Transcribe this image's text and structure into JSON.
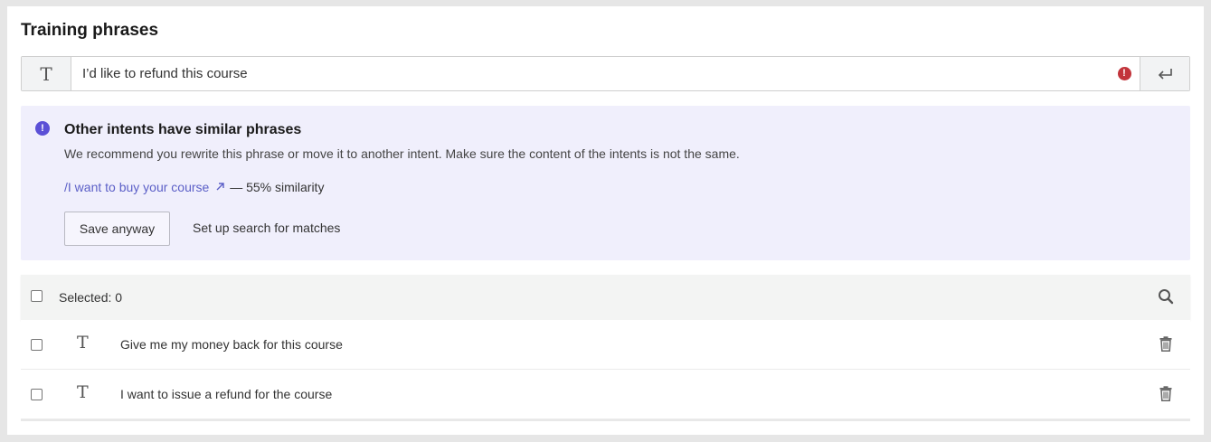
{
  "section": {
    "title": "Training phrases"
  },
  "phrase_input": {
    "type_icon": "text-type-icon",
    "value": "I’d like to refund this course",
    "error_icon": "error-icon",
    "enter_icon": "enter-icon"
  },
  "warning": {
    "icon": "info-icon",
    "title": "Other intents have similar phrases",
    "text": "We recommend you rewrite this phrase or move it to another intent. Make sure the content of the intents is not the same.",
    "link_text": "/I want to buy your course",
    "link_icon": "external-link-icon",
    "similarity": "— 55% similarity",
    "save_anyway_label": "Save anyway",
    "setup_search_label": "Set up search for matches",
    "accent": "#5b50d6",
    "background": "#f0effc"
  },
  "table": {
    "selected_label": "Selected: 0",
    "search_icon": "search-icon",
    "rows": [
      {
        "type_icon": "text-type-icon",
        "text": "Give me my money back for this course",
        "delete_icon": "trash-icon"
      },
      {
        "type_icon": "text-type-icon",
        "text": "I want to issue a refund for the course",
        "delete_icon": "trash-icon"
      }
    ]
  },
  "colors": {
    "error": "#c2343b",
    "link": "#5b5fc7"
  }
}
